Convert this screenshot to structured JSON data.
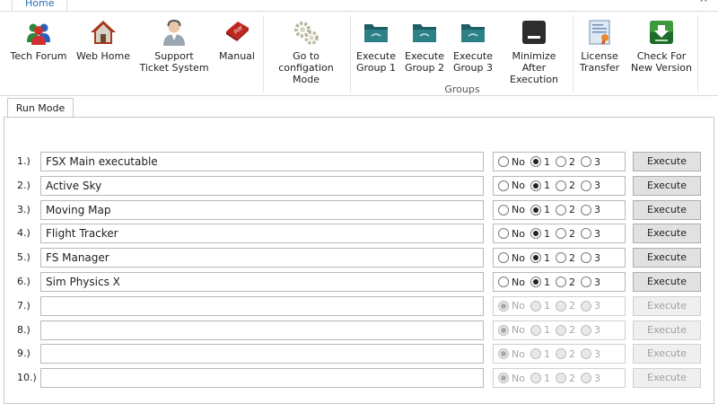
{
  "tabs": {
    "home": "Home",
    "collapse": "^"
  },
  "ribbon": {
    "buttons": [
      {
        "key": "tech_forum",
        "label": "Tech Forum",
        "icon": "users-icon"
      },
      {
        "key": "web_home",
        "label": "Web Home",
        "icon": "house-icon"
      },
      {
        "key": "support",
        "label": "Support\nTicket System",
        "icon": "support-person-icon"
      },
      {
        "key": "manual",
        "label": "Manual",
        "icon": "pdf-icon"
      },
      {
        "key": "config",
        "label": "Go to\nconfigation Mode",
        "icon": "gears-icon"
      },
      {
        "key": "group1",
        "label": "Execute\nGroup 1",
        "icon": "folder-icon"
      },
      {
        "key": "group2",
        "label": "Execute\nGroup 2",
        "icon": "folder-icon"
      },
      {
        "key": "group3",
        "label": "Execute\nGroup 3",
        "icon": "folder-icon"
      },
      {
        "key": "minimize",
        "label": "Minimize After\nExecution",
        "icon": "minimize-icon"
      },
      {
        "key": "license",
        "label": "License\nTransfer",
        "icon": "certificate-icon"
      },
      {
        "key": "update",
        "label": "Check For\nNew Version",
        "icon": "download-icon"
      }
    ],
    "groups_label": "Groups"
  },
  "run_mode_tab": "Run Mode",
  "options": [
    "No",
    "1",
    "2",
    "3"
  ],
  "execute_label": "Execute",
  "rows": [
    {
      "num": "1.)",
      "name": "FSX Main executable",
      "selected": "1",
      "enabled": true
    },
    {
      "num": "2.)",
      "name": "Active Sky",
      "selected": "1",
      "enabled": true
    },
    {
      "num": "3.)",
      "name": "Moving Map",
      "selected": "1",
      "enabled": true
    },
    {
      "num": "4.)",
      "name": "Flight Tracker",
      "selected": "1",
      "enabled": true
    },
    {
      "num": "5.)",
      "name": "FS Manager",
      "selected": "1",
      "enabled": true
    },
    {
      "num": "6.)",
      "name": "Sim Physics X",
      "selected": "1",
      "enabled": true
    },
    {
      "num": "7.)",
      "name": "",
      "selected": "No",
      "enabled": false
    },
    {
      "num": "8.)",
      "name": "",
      "selected": "No",
      "enabled": false
    },
    {
      "num": "9.)",
      "name": "",
      "selected": "No",
      "enabled": false
    },
    {
      "num": "10.)",
      "name": "",
      "selected": "No",
      "enabled": false
    }
  ]
}
